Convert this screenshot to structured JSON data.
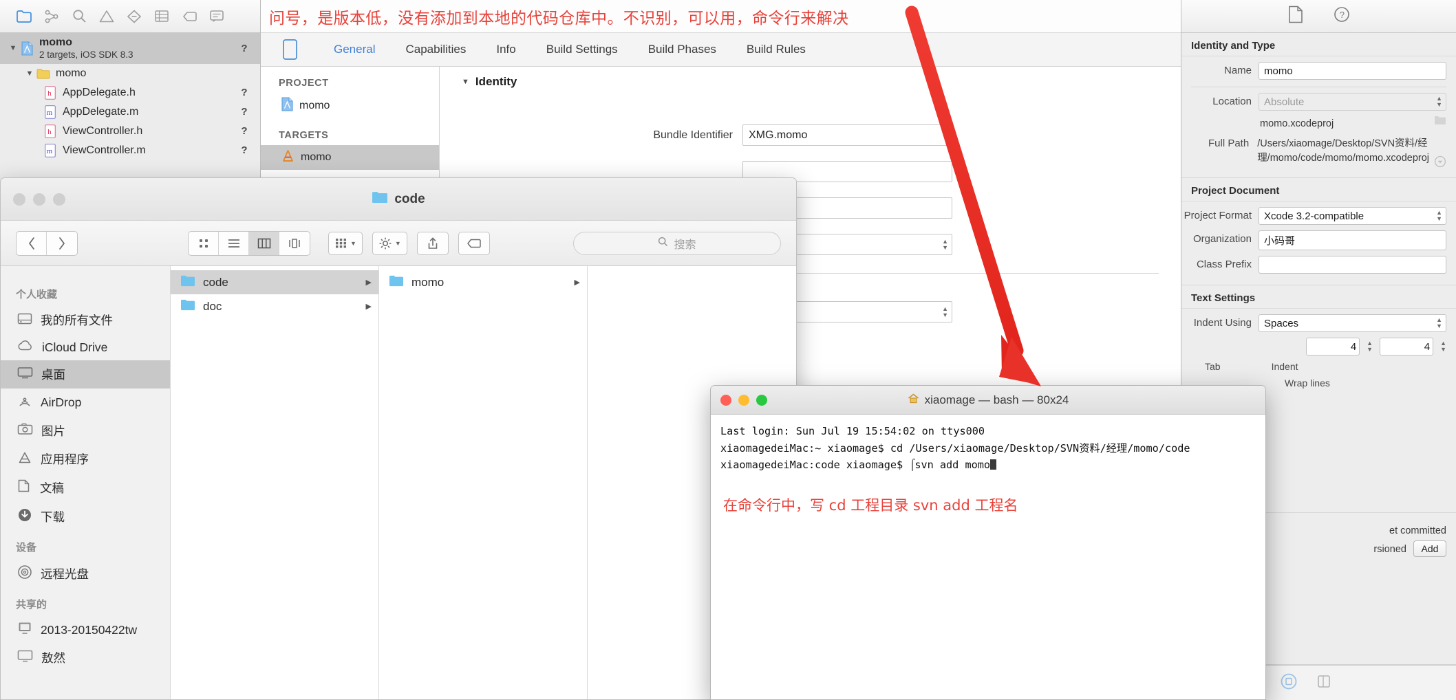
{
  "annotations": {
    "top_note": "问号，是版本低，没有添加到本地的代码仓库中。不识别，可以用，命令行来解决",
    "terminal_note": "在命令行中，写 cd 工程目录 svn add 工程名",
    "arrow_color": "#e8312a",
    "note_color": "#e8423a"
  },
  "xcode": {
    "navigator": {
      "toolbar_icons": [
        "folder-icon",
        "source-control-icon",
        "search-icon",
        "warning-icon",
        "breakpoint-icon",
        "test-icon",
        "tag-icon",
        "report-icon"
      ],
      "items": [
        {
          "name": "momo",
          "subtitle": "2 targets, iOS SDK 8.3",
          "icon": "project-icon",
          "badge": "?",
          "indent": 0,
          "selected": true,
          "twisty": "▼"
        },
        {
          "name": "momo",
          "subtitle": "",
          "icon": "folder-yellow-icon",
          "badge": "",
          "indent": 1,
          "selected": false,
          "twisty": "▼"
        },
        {
          "name": "AppDelegate.h",
          "subtitle": "",
          "icon": "header-file-icon",
          "badge": "?",
          "indent": 2,
          "selected": false,
          "twisty": ""
        },
        {
          "name": "AppDelegate.m",
          "subtitle": "",
          "icon": "source-file-icon",
          "badge": "?",
          "indent": 2,
          "selected": false,
          "twisty": ""
        },
        {
          "name": "ViewController.h",
          "subtitle": "",
          "icon": "header-file-icon",
          "badge": "?",
          "indent": 2,
          "selected": false,
          "twisty": ""
        },
        {
          "name": "ViewController.m",
          "subtitle": "",
          "icon": "source-file-icon",
          "badge": "?",
          "indent": 2,
          "selected": false,
          "twisty": ""
        }
      ]
    },
    "editor": {
      "tabs": [
        {
          "label": "General",
          "selected": true
        },
        {
          "label": "Capabilities",
          "selected": false
        },
        {
          "label": "Info",
          "selected": false
        },
        {
          "label": "Build Settings",
          "selected": false
        },
        {
          "label": "Build Phases",
          "selected": false
        },
        {
          "label": "Build Rules",
          "selected": false
        }
      ],
      "project_header": "PROJECT",
      "project_name": "momo",
      "targets_header": "TARGETS",
      "target_name": "momo",
      "section_identity": "Identity",
      "fields": [
        {
          "label": "Bundle Identifier",
          "value": "XMG.momo"
        },
        {
          "label": "",
          "value": ""
        },
        {
          "label": "",
          "value": ""
        }
      ]
    },
    "inspector": {
      "tab_icons": [
        "file-inspector-icon",
        "quick-help-icon"
      ],
      "identity": {
        "title": "Identity and Type",
        "name_label": "Name",
        "name_value": "momo",
        "location_label": "Location",
        "location_value": "Absolute",
        "file_name": "momo.xcodeproj",
        "full_path_label": "Full Path",
        "full_path": "/Users/xiaomage/Desktop/SVN资料/经理/momo/code/momo/momo.xcodeproj"
      },
      "document": {
        "title": "Project Document",
        "format_label": "Project Format",
        "format_value": "Xcode 3.2-compatible",
        "org_label": "Organization",
        "org_value": "小码哥",
        "prefix_label": "Class Prefix",
        "prefix_value": ""
      },
      "text_settings": {
        "title": "Text Settings",
        "indent_label": "Indent Using",
        "indent_value": "Spaces",
        "tab_label": "Tab",
        "tab_value": "4",
        "indent_width_label": "Indent",
        "indent_width_value": "4",
        "wrap_label": "Wrap lines"
      },
      "source_control": {
        "line1": "et committed",
        "line2": "rsioned",
        "add_button": "Add"
      }
    }
  },
  "finder": {
    "title": "code",
    "title_icon": "folder-blue-icon",
    "toolbar": {
      "back_icon": "chevron-left-icon",
      "forward_icon": "chevron-right-icon",
      "view_icons": [
        "icon-view-icon",
        "list-view-icon",
        "column-view-icon",
        "coverflow-view-icon"
      ],
      "arrange_icon": "grid-arrange-icon",
      "action_icon": "gear-icon",
      "share_icon": "share-icon",
      "tag_icon": "tag-icon",
      "search_placeholder": "搜索",
      "search_icon": "search-icon"
    },
    "sidebar": [
      {
        "type": "section",
        "label": "个人收藏"
      },
      {
        "type": "item",
        "label": "我的所有文件",
        "icon": "all-files-icon",
        "selected": false
      },
      {
        "type": "item",
        "label": "iCloud Drive",
        "icon": "icloud-icon",
        "selected": false
      },
      {
        "type": "item",
        "label": "桌面",
        "icon": "desktop-icon",
        "selected": true
      },
      {
        "type": "item",
        "label": "AirDrop",
        "icon": "airdrop-icon",
        "selected": false
      },
      {
        "type": "item",
        "label": "图片",
        "icon": "pictures-icon",
        "selected": false
      },
      {
        "type": "item",
        "label": "应用程序",
        "icon": "applications-icon",
        "selected": false
      },
      {
        "type": "item",
        "label": "文稿",
        "icon": "documents-icon",
        "selected": false
      },
      {
        "type": "item",
        "label": "下载",
        "icon": "downloads-icon",
        "selected": false
      },
      {
        "type": "section",
        "label": "设备"
      },
      {
        "type": "item",
        "label": "远程光盘",
        "icon": "remote-disc-icon",
        "selected": false
      },
      {
        "type": "section",
        "label": "共享的"
      },
      {
        "type": "item",
        "label": "2013-20150422tw",
        "icon": "computer-icon",
        "selected": false
      },
      {
        "type": "item",
        "label": "敖然",
        "icon": "display-icon",
        "selected": false
      }
    ],
    "columns": [
      {
        "items": [
          {
            "label": "code",
            "selected": true
          },
          {
            "label": "doc",
            "selected": false
          }
        ]
      },
      {
        "items": [
          {
            "label": "momo",
            "selected": false
          }
        ]
      },
      {
        "items": []
      }
    ]
  },
  "terminal": {
    "title": "xiaomage — bash — 80x24",
    "title_icon": "home-icon",
    "lines": [
      "Last login: Sun Jul 19 15:54:02 on ttys000",
      "xiaomagedeiMac:~ xiaomage$ cd /Users/xiaomage/Desktop/SVN资料/经理/momo/code",
      "xiaomagedeiMac:code xiaomage$ svn add momo"
    ],
    "prompt_prefix": "xiaomagedeiMac:code xiaomage$ ",
    "command": "svn add momo"
  }
}
